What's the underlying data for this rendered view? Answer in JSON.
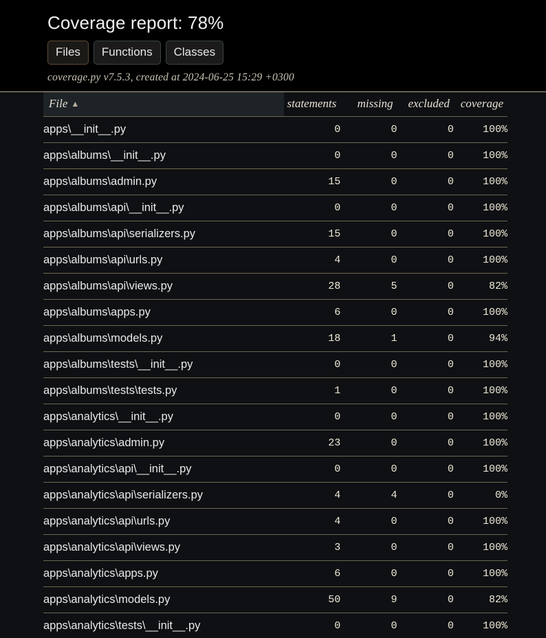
{
  "header": {
    "title": "Coverage report: 78%",
    "tabs": [
      {
        "label": "Files",
        "active": true
      },
      {
        "label": "Functions",
        "active": false
      },
      {
        "label": "Classes",
        "active": false
      }
    ],
    "meta": "coverage.py v7.5.3, created at 2024-06-25 15:29 +0300",
    "active_tab_border_color": "#5c4b35",
    "tab_border_color": "#3c4347",
    "divider_color": "#b0a98f"
  },
  "table": {
    "sort_indicator": "▲",
    "sorted_column": "File",
    "columns": [
      {
        "key": "file",
        "label": "File",
        "align": "left"
      },
      {
        "key": "statements",
        "label": "statements",
        "align": "right"
      },
      {
        "key": "missing",
        "label": "missing",
        "align": "right"
      },
      {
        "key": "excluded",
        "label": "excluded",
        "align": "right"
      },
      {
        "key": "coverage",
        "label": "coverage",
        "align": "right"
      }
    ],
    "row_separator_color": "#6e6750",
    "file_header_bg": "#1e2327",
    "rows": [
      {
        "file": "apps\\__init__.py",
        "statements": "0",
        "missing": "0",
        "excluded": "0",
        "coverage": "100%"
      },
      {
        "file": "apps\\albums\\__init__.py",
        "statements": "0",
        "missing": "0",
        "excluded": "0",
        "coverage": "100%"
      },
      {
        "file": "apps\\albums\\admin.py",
        "statements": "15",
        "missing": "0",
        "excluded": "0",
        "coverage": "100%"
      },
      {
        "file": "apps\\albums\\api\\__init__.py",
        "statements": "0",
        "missing": "0",
        "excluded": "0",
        "coverage": "100%"
      },
      {
        "file": "apps\\albums\\api\\serializers.py",
        "statements": "15",
        "missing": "0",
        "excluded": "0",
        "coverage": "100%"
      },
      {
        "file": "apps\\albums\\api\\urls.py",
        "statements": "4",
        "missing": "0",
        "excluded": "0",
        "coverage": "100%"
      },
      {
        "file": "apps\\albums\\api\\views.py",
        "statements": "28",
        "missing": "5",
        "excluded": "0",
        "coverage": "82%"
      },
      {
        "file": "apps\\albums\\apps.py",
        "statements": "6",
        "missing": "0",
        "excluded": "0",
        "coverage": "100%"
      },
      {
        "file": "apps\\albums\\models.py",
        "statements": "18",
        "missing": "1",
        "excluded": "0",
        "coverage": "94%"
      },
      {
        "file": "apps\\albums\\tests\\__init__.py",
        "statements": "0",
        "missing": "0",
        "excluded": "0",
        "coverage": "100%"
      },
      {
        "file": "apps\\albums\\tests\\tests.py",
        "statements": "1",
        "missing": "0",
        "excluded": "0",
        "coverage": "100%"
      },
      {
        "file": "apps\\analytics\\__init__.py",
        "statements": "0",
        "missing": "0",
        "excluded": "0",
        "coverage": "100%"
      },
      {
        "file": "apps\\analytics\\admin.py",
        "statements": "23",
        "missing": "0",
        "excluded": "0",
        "coverage": "100%"
      },
      {
        "file": "apps\\analytics\\api\\__init__.py",
        "statements": "0",
        "missing": "0",
        "excluded": "0",
        "coverage": "100%"
      },
      {
        "file": "apps\\analytics\\api\\serializers.py",
        "statements": "4",
        "missing": "4",
        "excluded": "0",
        "coverage": "0%"
      },
      {
        "file": "apps\\analytics\\api\\urls.py",
        "statements": "4",
        "missing": "0",
        "excluded": "0",
        "coverage": "100%"
      },
      {
        "file": "apps\\analytics\\api\\views.py",
        "statements": "3",
        "missing": "0",
        "excluded": "0",
        "coverage": "100%"
      },
      {
        "file": "apps\\analytics\\apps.py",
        "statements": "6",
        "missing": "0",
        "excluded": "0",
        "coverage": "100%"
      },
      {
        "file": "apps\\analytics\\models.py",
        "statements": "50",
        "missing": "9",
        "excluded": "0",
        "coverage": "82%"
      },
      {
        "file": "apps\\analytics\\tests\\__init__.py",
        "statements": "0",
        "missing": "0",
        "excluded": "0",
        "coverage": "100%"
      }
    ]
  }
}
